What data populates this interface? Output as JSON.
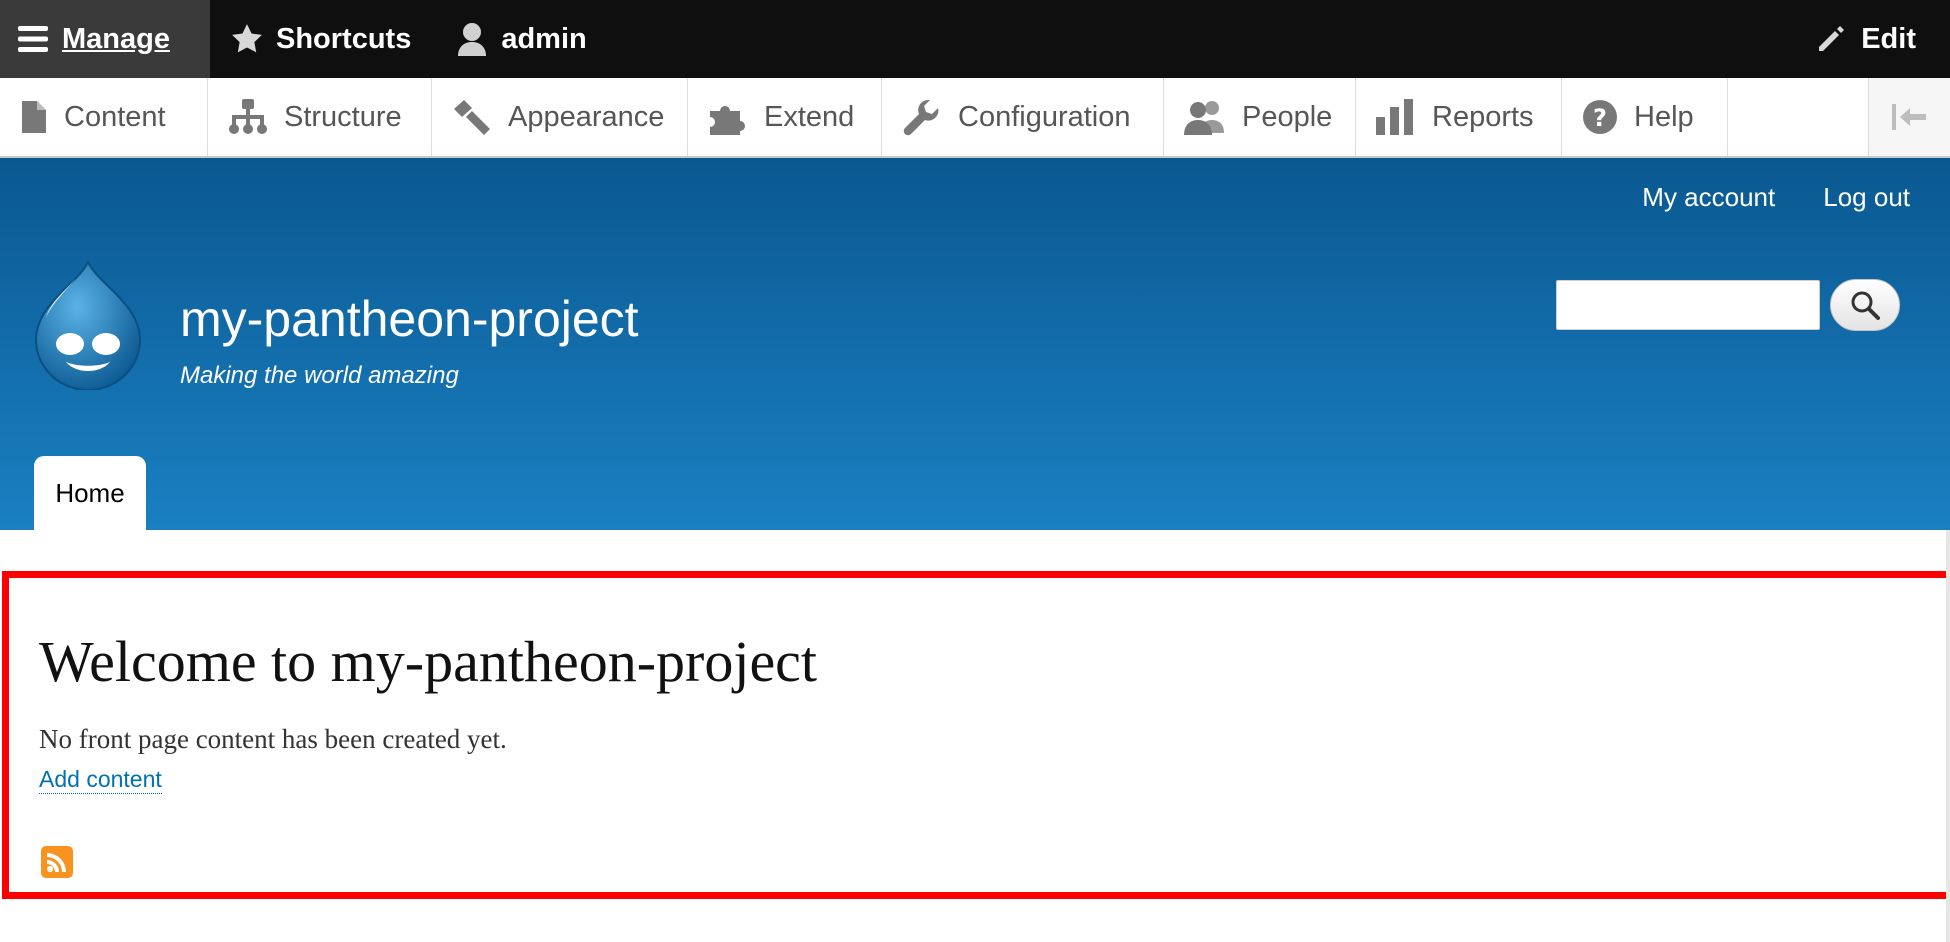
{
  "toolbar": {
    "manage_label": "Manage",
    "shortcuts_label": "Shortcuts",
    "user_label": "admin",
    "edit_label": "Edit"
  },
  "admin_menu": {
    "items": [
      {
        "label": "Content",
        "icon": "file-icon"
      },
      {
        "label": "Structure",
        "icon": "sitemap-icon"
      },
      {
        "label": "Appearance",
        "icon": "brush-icon"
      },
      {
        "label": "Extend",
        "icon": "puzzle-icon"
      },
      {
        "label": "Configuration",
        "icon": "wrench-icon"
      },
      {
        "label": "People",
        "icon": "people-icon"
      },
      {
        "label": "Reports",
        "icon": "bar-chart-icon"
      },
      {
        "label": "Help",
        "icon": "help-icon"
      }
    ]
  },
  "header": {
    "secondary_links": [
      "My account",
      "Log out"
    ],
    "site_name": "my-pantheon-project",
    "slogan": "Making the world amazing",
    "search_value": "",
    "nav_home": "Home"
  },
  "main": {
    "title": "Welcome to my-pantheon-project",
    "text": "No front page content has been created yet.",
    "add_content_link": "Add content"
  },
  "colors": {
    "toolbar_bg": "#0f0f0f",
    "header_top": "#0a5890",
    "header_bottom": "#1a80c2",
    "link": "#0071b3",
    "highlight_border": "#ff0000",
    "rss": "#f7931e"
  }
}
